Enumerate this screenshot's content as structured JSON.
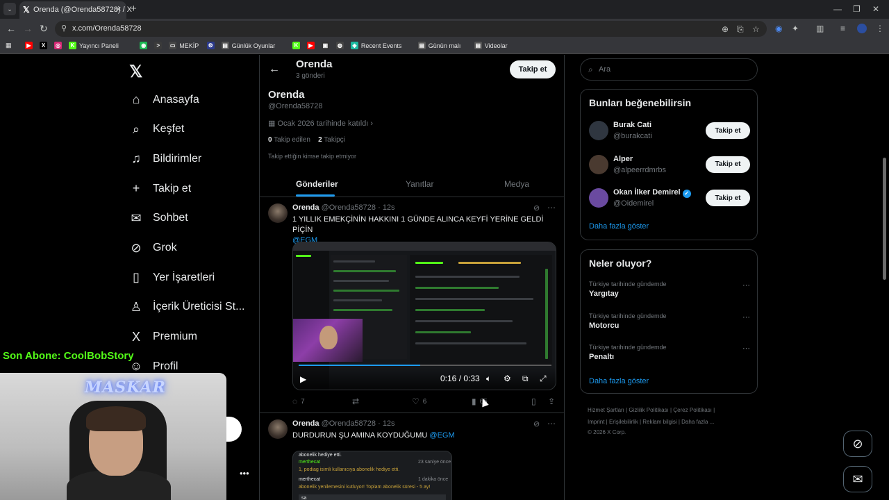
{
  "browser": {
    "tab_title": "Orenda (@Orenda58728) / X",
    "url": "x.com/Orenda58728",
    "bookmarks": [
      {
        "label": "",
        "color": "#ff0000",
        "glyph": "▶"
      },
      {
        "label": "",
        "color": "#000000",
        "glyph": "X"
      },
      {
        "label": "",
        "color": "#d62976",
        "glyph": "◎"
      },
      {
        "label": "Yayıncı Paneli",
        "color": "#53fc18",
        "glyph": "K"
      },
      {
        "label": "",
        "color": "#1db954",
        "glyph": "◉"
      },
      {
        "label": "",
        "color": "#3b3b3b",
        "glyph": ">"
      },
      {
        "label": "MEKİP",
        "color": "#444444",
        "glyph": "▭"
      },
      {
        "label": "",
        "color": "#2b3a8c",
        "glyph": "⚙"
      },
      {
        "label": "Günlük Oyunlar",
        "color": "#555555",
        "glyph": "▤"
      },
      {
        "label": "",
        "color": "#53fc18",
        "glyph": "K"
      },
      {
        "label": "",
        "color": "#ff0000",
        "glyph": "▶"
      },
      {
        "label": "",
        "color": "#333333",
        "glyph": "▣"
      },
      {
        "label": "",
        "color": "#444444",
        "glyph": "◍"
      },
      {
        "label": "Recent Events",
        "color": "#1db9a0",
        "glyph": "◈"
      },
      {
        "label": "Günün malı",
        "color": "#555555",
        "glyph": "▤"
      },
      {
        "label": "Videolar",
        "color": "#555555",
        "glyph": "▤"
      }
    ]
  },
  "sidebar": {
    "items": [
      {
        "label": "Anasayfa",
        "icon": "⌂"
      },
      {
        "label": "Keşfet",
        "icon": "⌕"
      },
      {
        "label": "Bildirimler",
        "icon": "♫"
      },
      {
        "label": "Takip et",
        "icon": "+"
      },
      {
        "label": "Sohbet",
        "icon": "✉"
      },
      {
        "label": "Grok",
        "icon": "⊘"
      },
      {
        "label": "Yer İşaretleri",
        "icon": "▯"
      },
      {
        "label": "İçerik Üreticisi St...",
        "icon": "♙"
      },
      {
        "label": "Premium",
        "icon": "X"
      },
      {
        "label": "Profil",
        "icon": "☺"
      }
    ]
  },
  "profile": {
    "header_name": "Orenda",
    "post_count": "3 gönderi",
    "follow_label": "Takip et",
    "name": "Orenda",
    "handle": "@Orenda58728",
    "joined": "Ocak 2026 tarihinde katıldı",
    "following_count": "0",
    "following_label": "Takip edilen",
    "followers_count": "2",
    "followers_label": "Takipçi",
    "note": "Takip ettiğin kimse takip etmiyor",
    "tabs": [
      "Gönderiler",
      "Yanıtlar",
      "Medya"
    ]
  },
  "posts": [
    {
      "name": "Orenda",
      "handle": "@Orenda58728",
      "time": "12s",
      "text": "1 YILLIK EMEKÇİNİN HAKKINI 1 GÜNDE ALINCA KEYFİ YERİNE GELDİ PİÇİN",
      "mention": "@EGM",
      "video_time": "0:16 / 0:33",
      "video_progress": 0.48,
      "replies": "7",
      "likes": "6",
      "views": "65"
    },
    {
      "name": "Orenda",
      "handle": "@Orenda58728",
      "time": "12s",
      "text": "DURDURUN ŞU AMINA KOYDUĞUMU",
      "mention": "@EGM",
      "media_lines": [
        {
          "user": "abonelik hediye etti.",
          "meta": ""
        },
        {
          "user": "merthecat",
          "meta": "23 saniye önce"
        },
        {
          "user": "1, podiag isimli kullanıcıya abonelik hediye etti.",
          "meta": ""
        },
        {
          "user": "merthecat",
          "meta": "1 dakika önce"
        },
        {
          "user": "abonelik yenilemesini kutluyor! Toplam abonelik süresi - 5 ay!",
          "meta": ""
        },
        {
          "user": "sa",
          "meta": ""
        }
      ]
    }
  ],
  "right": {
    "search_placeholder": "Ara",
    "suggest_title": "Bunları beğenebilirsin",
    "suggestions": [
      {
        "name": "Burak Cati",
        "handle": "@burakcati",
        "color": "#2f3640",
        "verified": false
      },
      {
        "name": "Alper",
        "handle": "@alpeerrdmrbs",
        "color": "#4a3a30",
        "verified": false
      },
      {
        "name": "Okan İlker Demirel",
        "handle": "@Oidemirel",
        "color": "#6a4aa0",
        "verified": true
      }
    ],
    "follow_label": "Takip et",
    "show_more": "Daha fazla göster",
    "trends_title": "Neler oluyor?",
    "trends": [
      {
        "context": "Türkiye tarihinde gündemde",
        "name": "Yargıtay"
      },
      {
        "context": "Türkiye tarihinde gündemde",
        "name": "Motorcu"
      },
      {
        "context": "Türkiye tarihinde gündemde",
        "name": "Penaltı"
      }
    ],
    "footer_line1": "Hizmet Şartları  |  Gizlilik Politikası  |  Çerez Politikası  |",
    "footer_line2": "Imprint  |  Erişilebilirlik  |  Reklam bilgisi  |  Daha fazla ...",
    "footer_line3": "© 2026 X Corp."
  },
  "overlay": {
    "last_sub": "Son Abone: CoolBobStory",
    "neon_sign": "MASKAR"
  }
}
